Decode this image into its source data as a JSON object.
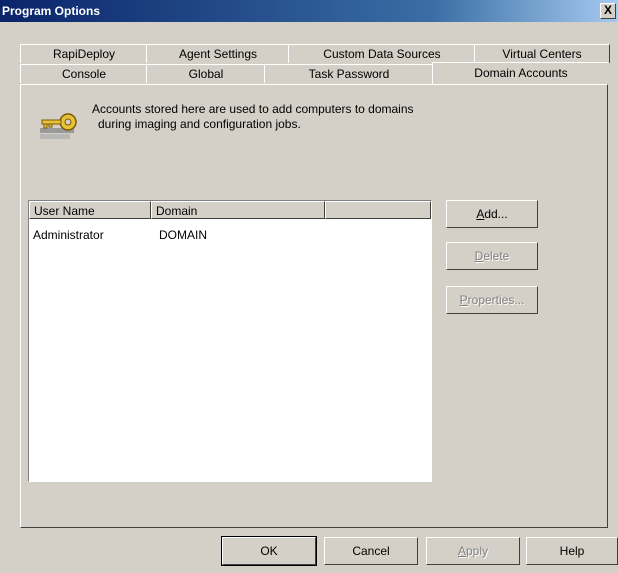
{
  "window": {
    "title": "Program Options",
    "close_glyph": "X"
  },
  "tabs_row1": [
    {
      "label": "RapiDeploy"
    },
    {
      "label": "Agent Settings"
    },
    {
      "label": "Custom Data Sources"
    },
    {
      "label": "Virtual Centers"
    }
  ],
  "tabs_row2": [
    {
      "label": "Console"
    },
    {
      "label": "Global"
    },
    {
      "label": "Task Password"
    },
    {
      "label": "Domain Accounts"
    }
  ],
  "active_tab": "Domain Accounts",
  "info": {
    "icon": "key-icon",
    "line1": "Accounts stored here are used to add computers to domains",
    "line2": "during imaging and configuration jobs."
  },
  "accounts_table": {
    "columns": [
      "User Name",
      "Domain",
      ""
    ],
    "rows": [
      {
        "user": "Administrator",
        "domain": "DOMAIN"
      }
    ]
  },
  "side_buttons": {
    "add": {
      "label_u": "A",
      "label_rest": "dd..."
    },
    "delete": {
      "label_u": "D",
      "label_rest": "elete"
    },
    "properties": {
      "label_u": "P",
      "label_rest": "roperties..."
    }
  },
  "footer_buttons": {
    "ok": "OK",
    "cancel": "Cancel",
    "apply_u": "A",
    "apply_rest": "pply",
    "help": "Help"
  }
}
